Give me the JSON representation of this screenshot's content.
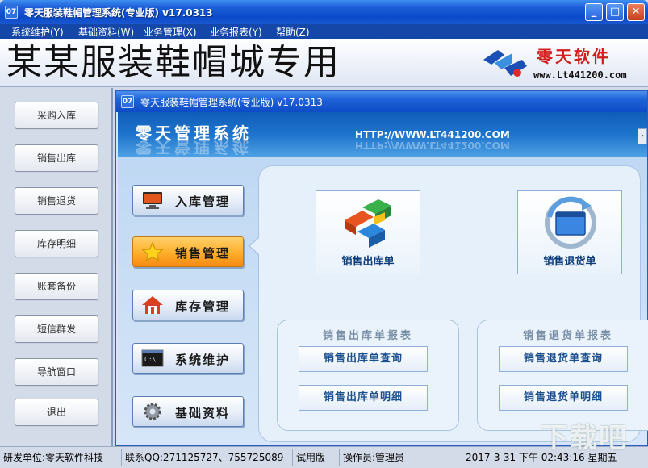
{
  "window": {
    "title": "零天服装鞋帽管理系统(专业版)  v17.0313",
    "icon_label": "07",
    "controls": [
      "_",
      "□",
      "✕"
    ]
  },
  "menu": [
    "系统维护(Y)",
    "基础资料(W)",
    "业务管理(X)",
    "业务报表(Y)",
    "帮助(Z)"
  ],
  "banner": {
    "shop_name": "某某服装鞋帽城专用",
    "brand": "零天软件",
    "url": "www.Lt441200.com"
  },
  "sidebar": {
    "items": [
      "采购入库",
      "销售出库",
      "销售退货",
      "库存明细",
      "账套备份",
      "短信群发",
      "导航窗口",
      "退出"
    ]
  },
  "inner_window": {
    "title": "零天服装鞋帽管理系统(专业版) v17.0313",
    "icon_label": "07",
    "banner_name": "零天管理系统",
    "banner_url": "HTTP://WWW.LT441200.COM",
    "scroll_arrow": "›"
  },
  "nav": {
    "items": [
      {
        "label": "入库管理",
        "icon": "monitor-icon",
        "active": false
      },
      {
        "label": "销售管理",
        "icon": "star-icon",
        "active": true
      },
      {
        "label": "库存管理",
        "icon": "house-icon",
        "active": false
      },
      {
        "label": "系统维护",
        "icon": "terminal-icon",
        "active": false
      },
      {
        "label": "基础资料",
        "icon": "gear-icon",
        "active": false
      }
    ]
  },
  "main": {
    "sales_out_label": "销售出库单",
    "sales_return_label": "销售退货单",
    "sales_out_group": {
      "title": "销售出库单报表",
      "query": "销售出库单查询",
      "detail": "销售出库单明细"
    },
    "sales_return_group": {
      "title": "销售退货单报表",
      "query": "销售退货单查询",
      "detail": "销售退货单明细"
    }
  },
  "status": {
    "developer": "研发单位:零天软件科技",
    "contact": "联系QQ:271125727、755725089",
    "edition": "试用版",
    "operator": "操作员:管理员",
    "datetime": "2017-3-31  下午  02:43:16 星期五"
  },
  "watermark": "下载吧",
  "colors": {
    "titlebar": "#0a49c9",
    "menubar": "#1547a8",
    "active_nav": "#ffae2b",
    "brand_red": "#d41e1e"
  }
}
